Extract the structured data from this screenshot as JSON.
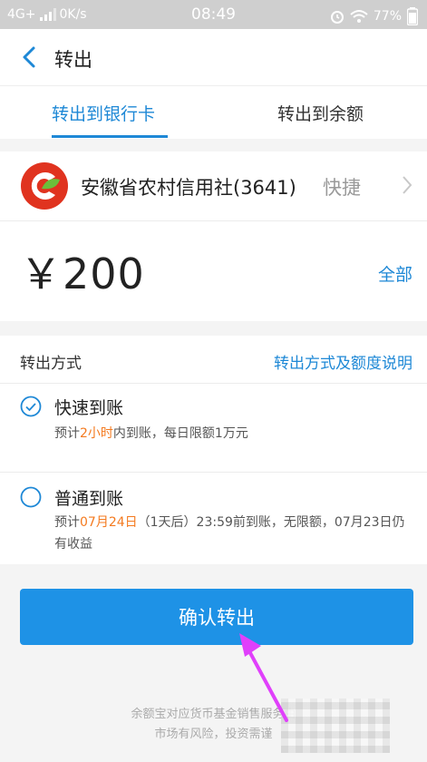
{
  "status_bar": {
    "network": "4G+",
    "speed": "0K/s",
    "time": "08:49",
    "battery": "77%",
    "icons": [
      "signal-icon",
      "alarm-icon",
      "wifi-icon",
      "battery-icon"
    ]
  },
  "nav": {
    "title": "转出",
    "back_icon": "chevron-left-icon"
  },
  "tabs": [
    {
      "label": "转出到银行卡",
      "active": true
    },
    {
      "label": "转出到余额",
      "active": false
    }
  ],
  "bank": {
    "name": "安徽省农村信用社(3641)",
    "tag": "快捷",
    "logo_icon": "bank-logo-icon"
  },
  "amount": {
    "symbol": "￥",
    "value": "200",
    "all_label": "全部"
  },
  "method": {
    "header": "转出方式",
    "help_link": "转出方式及额度说明",
    "options": [
      {
        "title": "快速到账",
        "selected": true,
        "desc_pre": "预计",
        "desc_highlight": "2小时",
        "desc_post": "内到账，每日限额1万元"
      },
      {
        "title": "普通到账",
        "selected": false,
        "desc_pre": "预计",
        "desc_highlight": "07月24日",
        "desc_post": "（1天后）23:59前到账，无限额，07月23日仍有收益"
      }
    ]
  },
  "confirm_label": "确认转出",
  "footer": {
    "line1": "余额宝对应货币基金销售服务由",
    "line2": "市场有风险，投资需谨"
  },
  "colors": {
    "accent": "#1e88d6",
    "button": "#1e92e6",
    "highlight": "#f47a1f",
    "annotation_arrow": "#e040fb"
  }
}
